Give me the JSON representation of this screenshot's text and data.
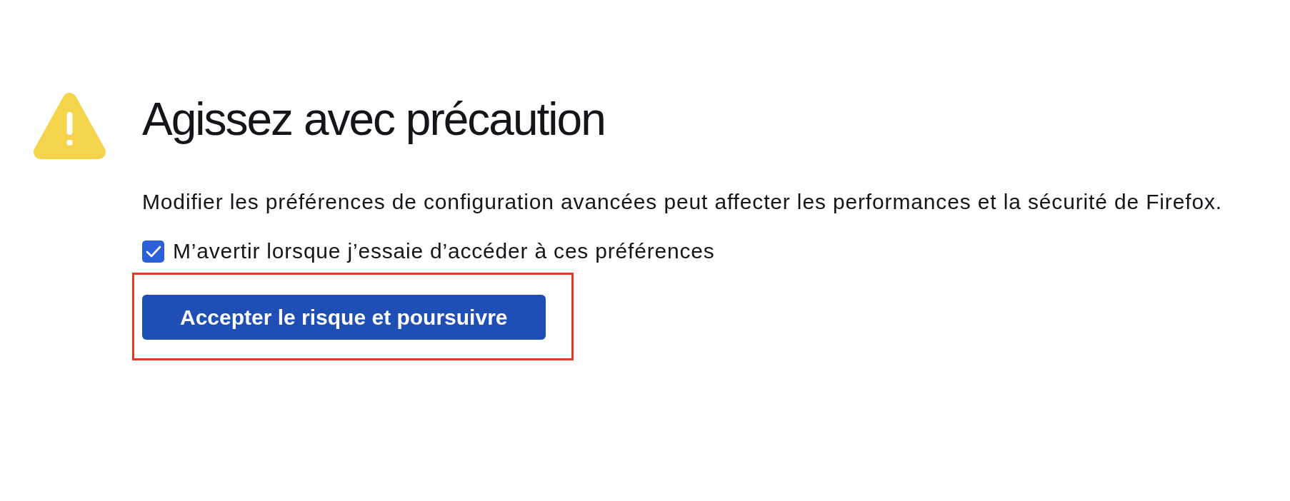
{
  "warning": {
    "title": "Agissez avec précaution",
    "message": "Modifier les préférences de configuration avancées peut affecter les performances et la sécurité de Firefox.",
    "checkbox": {
      "label": "M’avertir lorsque j’essaie d’accéder à ces préférences",
      "checked": true
    },
    "button": {
      "label": "Accepter le risque et poursuivre",
      "highlighted": true
    }
  }
}
